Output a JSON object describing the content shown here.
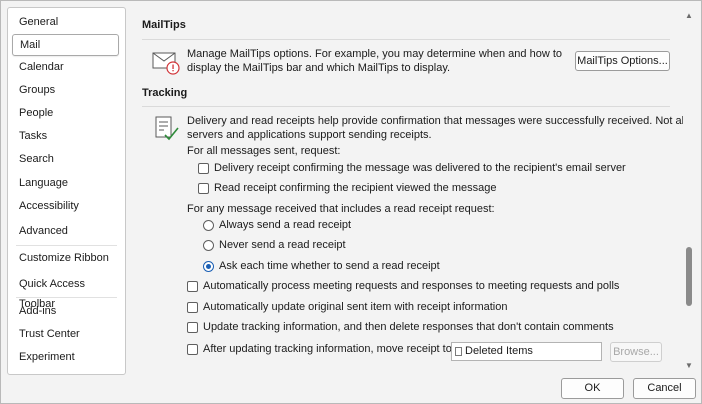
{
  "sidebar": {
    "items": [
      {
        "label": "General"
      },
      {
        "label": "Mail"
      },
      {
        "label": "Calendar"
      },
      {
        "label": "Groups"
      },
      {
        "label": "People"
      },
      {
        "label": "Tasks"
      },
      {
        "label": "Search"
      },
      {
        "label": "Language"
      },
      {
        "label": "Accessibility"
      },
      {
        "label": "Advanced"
      },
      {
        "label": "Customize Ribbon"
      },
      {
        "label": "Quick Access Toolbar"
      },
      {
        "label": "Add-ins"
      },
      {
        "label": "Trust Center"
      },
      {
        "label": "Experiment"
      }
    ],
    "selected": "Mail"
  },
  "mailtips": {
    "title": "MailTips",
    "description_line1": "Manage MailTips options. For example, you may determine when and how to",
    "description_line2": "display the MailTips bar and which MailTips to display.",
    "button_label": "MailTips Options..."
  },
  "tracking": {
    "title": "Tracking",
    "description_line1": "Delivery and read receipts help provide confirmation that messages were successfully received. Not all email",
    "description_line2": "servers and applications support sending receipts.",
    "sent_heading": "For all messages sent, request:",
    "delivery_receipt": {
      "label": "Delivery receipt confirming the message was delivered to the recipient's email server",
      "checked": false
    },
    "read_receipt": {
      "label": "Read receipt confirming the recipient viewed the message",
      "checked": false
    },
    "received_heading": "For any message received that includes a read receipt request:",
    "radio_always": {
      "label": "Always send a read receipt",
      "selected": false
    },
    "radio_never": {
      "label": "Never send a read receipt",
      "selected": false
    },
    "radio_ask": {
      "label": "Ask each time whether to send a read receipt",
      "selected": true
    },
    "auto_process": {
      "label": "Automatically process meeting requests and responses to meeting requests and polls",
      "checked": false
    },
    "auto_update": {
      "label": "Automatically update original sent item with receipt information",
      "checked": false
    },
    "update_tracking": {
      "label": "Update tracking information, and then delete responses that don't contain comments",
      "checked": false
    },
    "move_receipt": {
      "label": "After updating tracking information, move receipt to:",
      "checked": false
    },
    "folder_value": "Deleted Items",
    "browse_label": "Browse..."
  },
  "footer": {
    "ok_label": "OK",
    "cancel_label": "Cancel"
  },
  "colors": {
    "accent": "#1a5fb4",
    "alert_red": "#d13438",
    "check_green": "#2e8b3a"
  }
}
